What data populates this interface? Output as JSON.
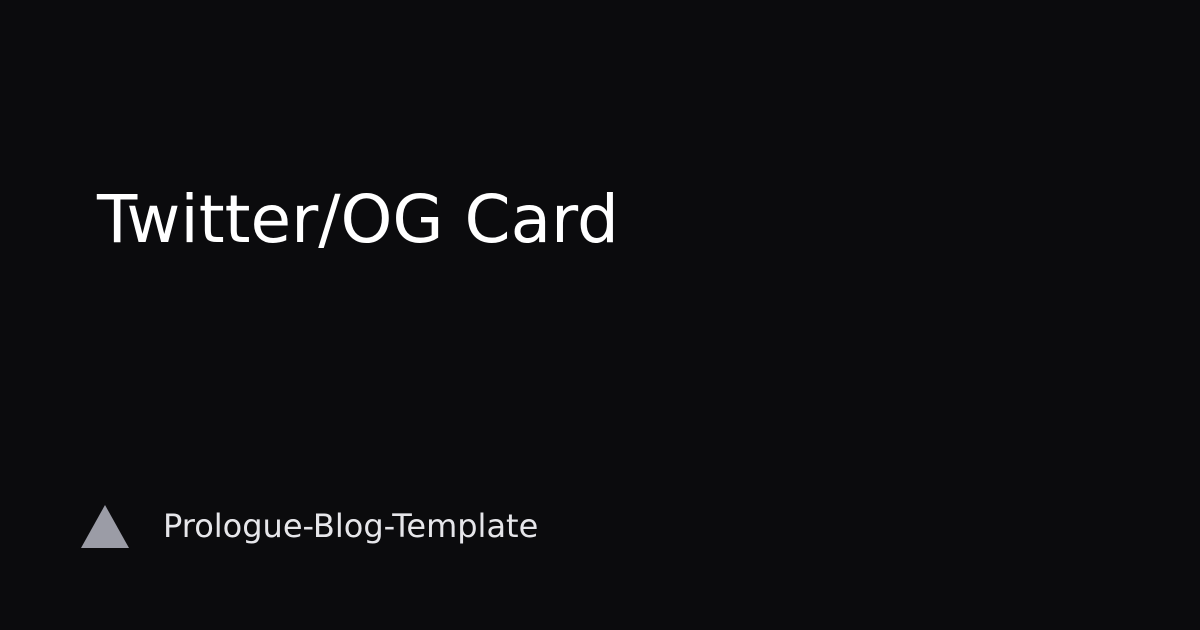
{
  "card": {
    "title": "Twitter/OG Card",
    "site_name": "Prologue-Blog-Template",
    "logo_icon": "triangle-icon"
  },
  "colors": {
    "background": "#0b0b0d",
    "title_text": "#ffffff",
    "site_text": "#e6e6ea",
    "logo": "#9b9ca6"
  }
}
